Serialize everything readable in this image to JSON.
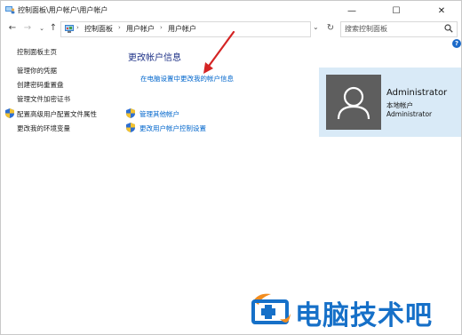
{
  "window": {
    "title": "控制面板\\用户帐户\\用户帐户",
    "minimize_glyph": "—",
    "maximize_glyph": "☐",
    "close_glyph": "✕"
  },
  "nav": {
    "back_glyph": "←",
    "forward_glyph": "→",
    "recent_glyph": "⌄",
    "up_glyph": "↑"
  },
  "address": {
    "crumbs": [
      "控制面板",
      "用户帐户",
      "用户帐户"
    ],
    "separator": "›",
    "dropdown_glyph": "⌄",
    "refresh_glyph": "↻"
  },
  "search": {
    "placeholder": "搜索控制面板",
    "icon": "search-icon"
  },
  "help": {
    "glyph": "?"
  },
  "sidebar": {
    "items": [
      {
        "label": "控制面板主页",
        "icon": ""
      },
      {
        "label": "管理你的凭据",
        "icon": ""
      },
      {
        "label": "创建密码重置盘",
        "icon": ""
      },
      {
        "label": "管理文件加密证书",
        "icon": ""
      },
      {
        "label": "配置高级用户配置文件属性",
        "icon": "shield-icon"
      },
      {
        "label": "更改我的环境变量",
        "icon": ""
      }
    ]
  },
  "main": {
    "title": "更改帐户信息",
    "pc_settings_link": "在电脑设置中更改我的帐户信息",
    "manage_other_link": "管理其他帐户",
    "uac_link": "更改用户帐户控制设置"
  },
  "user": {
    "name": "Administrator",
    "type": "本地帐户",
    "account": "Administrator",
    "tile_color": "#d9eaf7",
    "avatar_color": "#5e5e5e"
  },
  "annotation": {
    "arrow_color": "#d42424"
  },
  "watermark": {
    "text": "电脑技术吧",
    "color": "#1670c8",
    "accent_color": "#f28c1e"
  }
}
